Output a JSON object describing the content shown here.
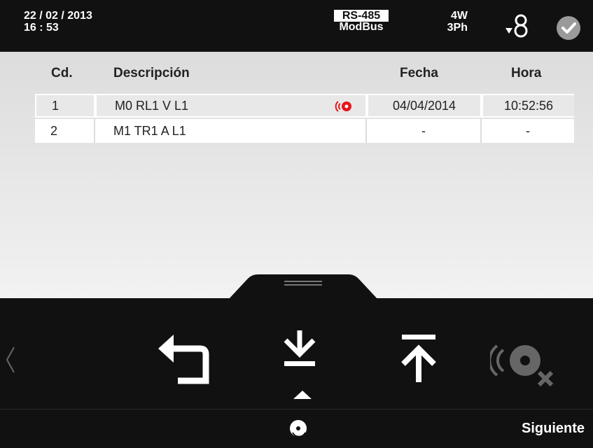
{
  "status_bar": {
    "date": "22 / 02 / 2013",
    "time": "16 : 53",
    "protocol_top": "RS-485",
    "protocol_bottom": "ModBus",
    "wiring_top": "4W",
    "wiring_bottom": "3Ph",
    "icons": [
      "current-transformer-icon",
      "checkmark-icon"
    ]
  },
  "table": {
    "headers": {
      "code": "Cd.",
      "description": "Descripción",
      "date": "Fecha",
      "time": "Hora"
    },
    "rows": [
      {
        "code": "1",
        "description": "M0 RL1 V L1",
        "date": "04/04/2014",
        "time": "10:52:56",
        "alarm_active": true
      },
      {
        "code": "2",
        "description": "M1 TR1 A L1",
        "date": "-",
        "time": "-",
        "alarm_active": false
      }
    ]
  },
  "actions": {
    "icons": [
      "back-icon",
      "download-icon",
      "upload-icon",
      "alarm-disabled-icon"
    ],
    "selected": "download-icon"
  },
  "footer": {
    "next_label": "Siguiente",
    "icon": "disc-icon"
  },
  "colors": {
    "alarm_red": "#e8141b",
    "bar_background": "#111111",
    "content_background": "#e6e6e6"
  }
}
